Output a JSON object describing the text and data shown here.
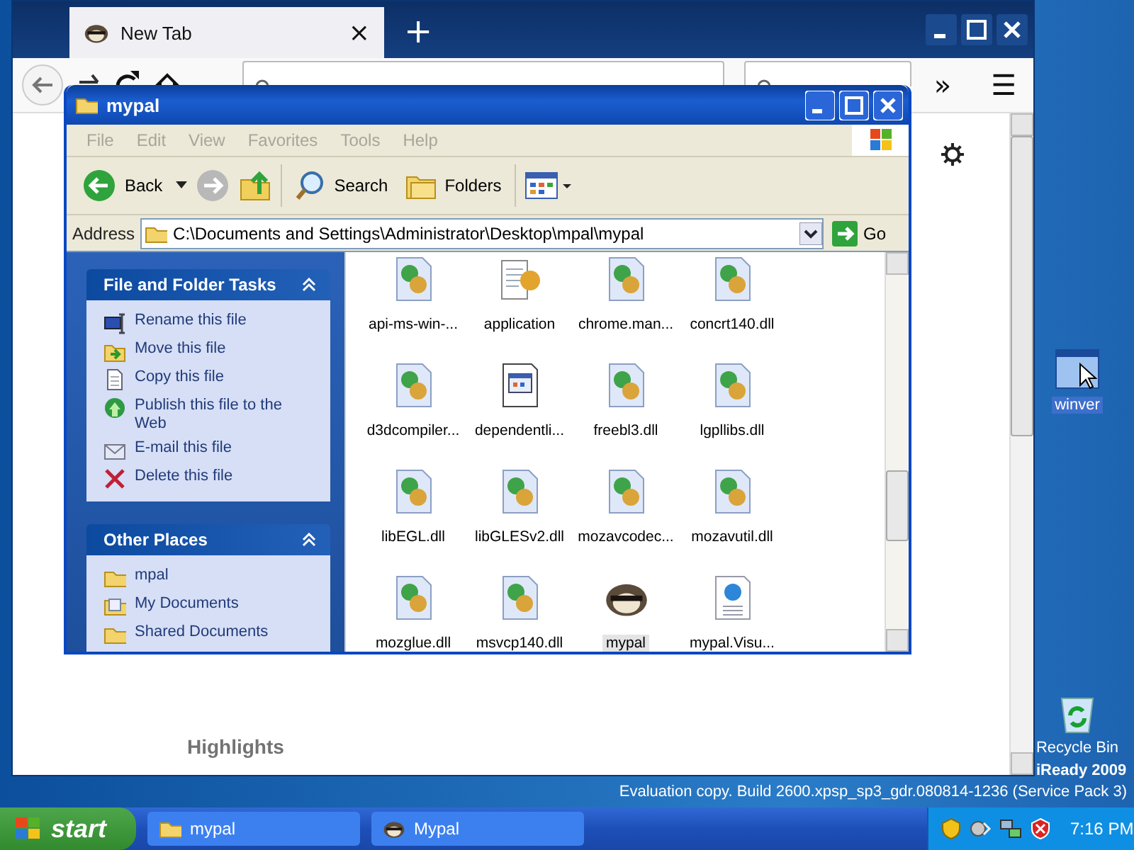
{
  "browser": {
    "tab": {
      "title": "New Tab",
      "close": "×"
    },
    "new_tab": "+",
    "overflow": "»",
    "menu": "☰",
    "content": {
      "section": "Highlights"
    }
  },
  "explorer": {
    "title": "mypal",
    "menu": [
      {
        "label": "File",
        "disabled": true
      },
      {
        "label": "Edit",
        "disabled": true
      },
      {
        "label": "View",
        "disabled": true
      },
      {
        "label": "Favorites",
        "disabled": true
      },
      {
        "label": "Tools",
        "disabled": true
      },
      {
        "label": "Help",
        "disabled": true
      }
    ],
    "toolbar": {
      "back": "Back",
      "search": "Search",
      "folders": "Folders"
    },
    "address": {
      "label": "Address",
      "value": "C:\\Documents and Settings\\Administrator\\Desktop\\mpal\\mypal",
      "go": "Go"
    },
    "panels": [
      {
        "title": "File and Folder Tasks",
        "items": [
          {
            "label": "Rename this file",
            "kind": "rename"
          },
          {
            "label": "Move this file",
            "kind": "move"
          },
          {
            "label": "Copy this file",
            "kind": "copy"
          },
          {
            "label": "Publish this file to the Web",
            "kind": "publish"
          },
          {
            "label": "E-mail this file",
            "kind": "email"
          },
          {
            "label": "Delete this file",
            "kind": "delete"
          }
        ]
      },
      {
        "title": "Other Places",
        "items": [
          {
            "label": "mpal",
            "kind": "folder"
          },
          {
            "label": "My Documents",
            "kind": "documents"
          },
          {
            "label": "Shared Documents",
            "kind": "folder"
          }
        ]
      }
    ],
    "files": [
      {
        "name": "api-ms-win-...",
        "kind": "dll",
        "selected": false
      },
      {
        "name": "application",
        "kind": "exe",
        "selected": false
      },
      {
        "name": "chrome.man...",
        "kind": "dll",
        "selected": false
      },
      {
        "name": "concrt140.dll",
        "kind": "dll",
        "selected": false
      },
      {
        "name": "d3dcompiler...",
        "kind": "dll",
        "selected": false
      },
      {
        "name": "dependentli...",
        "kind": "manifest",
        "selected": false
      },
      {
        "name": "freebl3.dll",
        "kind": "dll",
        "selected": false
      },
      {
        "name": "lgpllibs.dll",
        "kind": "dll",
        "selected": false
      },
      {
        "name": "libEGL.dll",
        "kind": "dll",
        "selected": false
      },
      {
        "name": "libGLESv2.dll",
        "kind": "dll",
        "selected": false
      },
      {
        "name": "mozavcodec...",
        "kind": "dll",
        "selected": false
      },
      {
        "name": "mozavutil.dll",
        "kind": "dll",
        "selected": false
      },
      {
        "name": "mozglue.dll",
        "kind": "dll",
        "selected": false
      },
      {
        "name": "msvcp140.dll",
        "kind": "dll",
        "selected": false
      },
      {
        "name": "mypal",
        "kind": "app",
        "selected": true
      },
      {
        "name": "mypal.Visu...",
        "kind": "web",
        "selected": false
      }
    ]
  },
  "desktop": {
    "icons": [
      {
        "label": "winver",
        "kind": "window",
        "selected": true
      },
      {
        "label": "Recycle Bin",
        "kind": "recycle",
        "selected": false
      }
    ],
    "caption": "iReady 2009",
    "build": "Evaluation copy. Build 2600.xpsp_sp3_gdr.080814-1236 (Service Pack 3)"
  },
  "taskbar": {
    "start": "start",
    "tasks": [
      {
        "label": "mypal",
        "kind": "folder",
        "selected": false
      },
      {
        "label": "Mypal",
        "kind": "app",
        "selected": false
      }
    ],
    "clock": "7:16 PM"
  }
}
